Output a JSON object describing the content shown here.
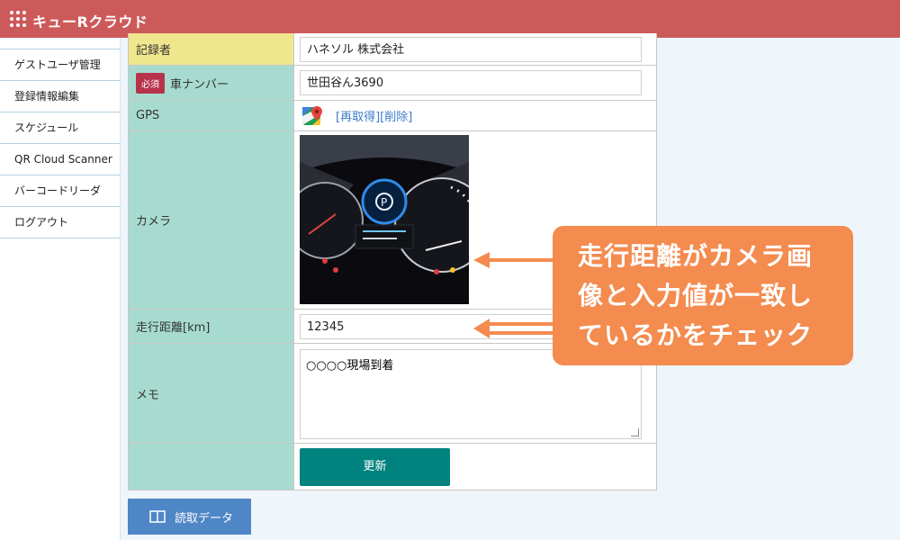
{
  "app": {
    "title": "キューRクラウド"
  },
  "sidebar": {
    "items": [
      {
        "label": "ゲストユーザ管理"
      },
      {
        "label": "登録情報編集"
      },
      {
        "label": "スケジュール"
      },
      {
        "label": "QR Cloud Scanner"
      },
      {
        "label": "バーコードリーダ"
      },
      {
        "label": "ログアウト"
      }
    ]
  },
  "form": {
    "recorder": {
      "label": "記録者",
      "value": "ハネソル 株式会社"
    },
    "plate": {
      "required": "必須",
      "label": "車ナンバー",
      "value": "世田谷ん3690"
    },
    "gps": {
      "label": "GPS",
      "links": "[再取得][削除]"
    },
    "camera": {
      "label": "カメラ"
    },
    "mileage": {
      "label": "走行距離[km]",
      "value": "12345"
    },
    "memo": {
      "label": "メモ",
      "value": "○○○○現場到着"
    },
    "update_label": "更新"
  },
  "read_button": {
    "label": "読取データ"
  },
  "callout": {
    "line1": "走行距離がカメラ画",
    "line2": "像と入力値が一致し",
    "line3": "ているかをチェック"
  },
  "colors": {
    "topbar": "#cd5a5a",
    "accent": "#f48b4f",
    "label_cell": "#a8dbd0",
    "update": "#00827e"
  },
  "icons": [
    "grid-icon",
    "google-maps-icon",
    "book-icon"
  ]
}
